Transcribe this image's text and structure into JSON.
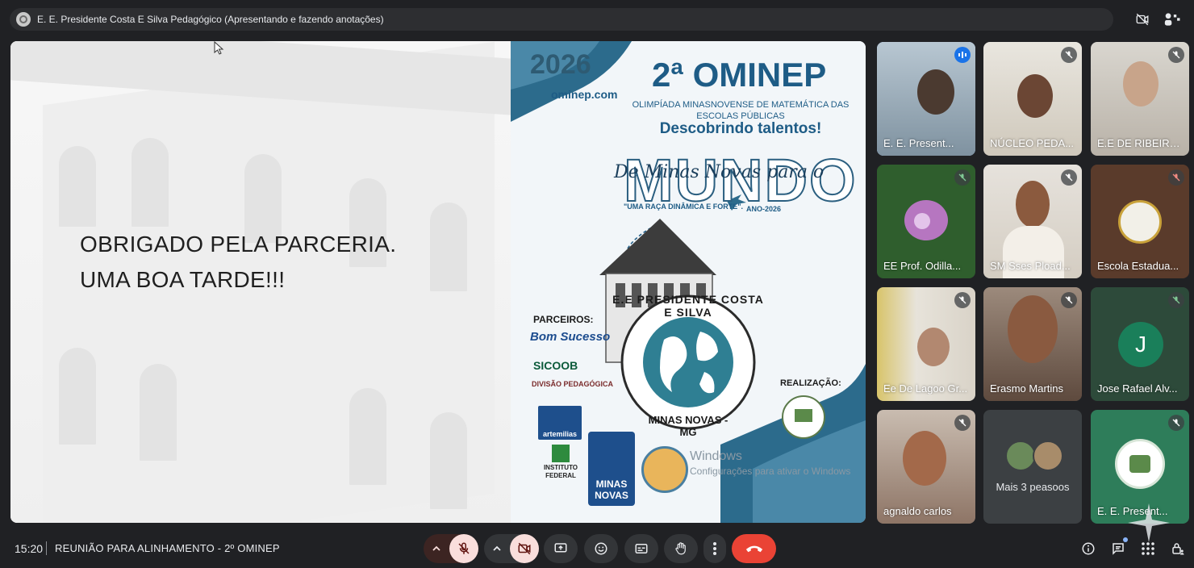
{
  "presenter_bar": {
    "title": "E. E. Presidente Costa E Silva Pedagógico (Apresentando e fazendo anotações)"
  },
  "slide": {
    "left_text_line1": "OBRIGADO PELA PARCERIA.",
    "left_text_line2": "UMA BOA TARDE!!!",
    "year": "2026",
    "site": "ominep.com",
    "title": "2ª OMINEP",
    "subtitle": "OLIMPÍADA MINASNOVENSE DE MATEMÁTICA DAS ESCOLAS PÚBLICAS",
    "slogan": "Descobrindo talentos!",
    "mundo": "MUNDO",
    "script": "De Minas Novas para o",
    "quote": "\"UMA RAÇA DINÂMICA E FORTE\".",
    "ano": "ANO-2026",
    "school_arc_top": "E.E PRESIDENTE COSTA E SILVA",
    "school_arc_bottom": "MINAS NOVAS - MG",
    "partners_label": "PARCEIROS:",
    "realizacao_label": "REALIZAÇÃO:",
    "sponsor_bom_sucesso": "Bom Sucesso",
    "sponsor_sicoob": "SICOOB",
    "sponsor_divisao": "DIVISÃO PEDAGÓGICA",
    "sponsor_artemilias": "artemilias",
    "sponsor_if_line1": "INSTITUTO",
    "sponsor_if_line2": "FEDERAL",
    "sponsor_minas_line1": "MINAS",
    "sponsor_minas_line2": "NOVAS",
    "watermark_line1": "Windows",
    "watermark_line2": "Configurações para ativar o Windows"
  },
  "participants": [
    {
      "name": "E. E. Presidente Costa E Silva",
      "display": "E. E. Present...",
      "active": true
    },
    {
      "name": "NÚCLEO PEDAGÓGICO",
      "display": "NÚCLEO PEDA..."
    },
    {
      "name": "E.E DE RIBEIRÃO",
      "display": "E.E DE RIBEIRÃO"
    },
    {
      "name": "EE Prof. Odilla",
      "display": "EE Prof. Odilla..."
    },
    {
      "name": "SM Sses Pload",
      "display": "SM Sses Pload..."
    },
    {
      "name": "Escola Estadual",
      "display": "Escola Estadua..."
    },
    {
      "name": "Ee De Lagoo Gr",
      "display": "Ee De Lagoo Gr..."
    },
    {
      "name": "Erasmo Martins",
      "display": "Erasmo Martins"
    },
    {
      "name": "Jose Rafael Alv",
      "display": "Jose Rafael Alv...",
      "initial": "J"
    },
    {
      "name": "agnaldo carlos",
      "display": "agnaldo carlos"
    },
    {
      "name": "Mais 3 peasoos",
      "display": "Mais 3 peasoos"
    },
    {
      "name": "E. E. Presidente",
      "display": "E. E. Present..."
    }
  ],
  "bottom_bar": {
    "time": "15:20",
    "meeting_title": "REUNIÃO PARA ALINHAMENTO - 2º OMINEP"
  },
  "colors": {
    "background": "#202124",
    "tile": "#3c4043",
    "end_call": "#ea4335",
    "muted_button": "#f9dedc",
    "accent_blue": "#8ab4f8",
    "brand_blue": "#1e5c86"
  }
}
